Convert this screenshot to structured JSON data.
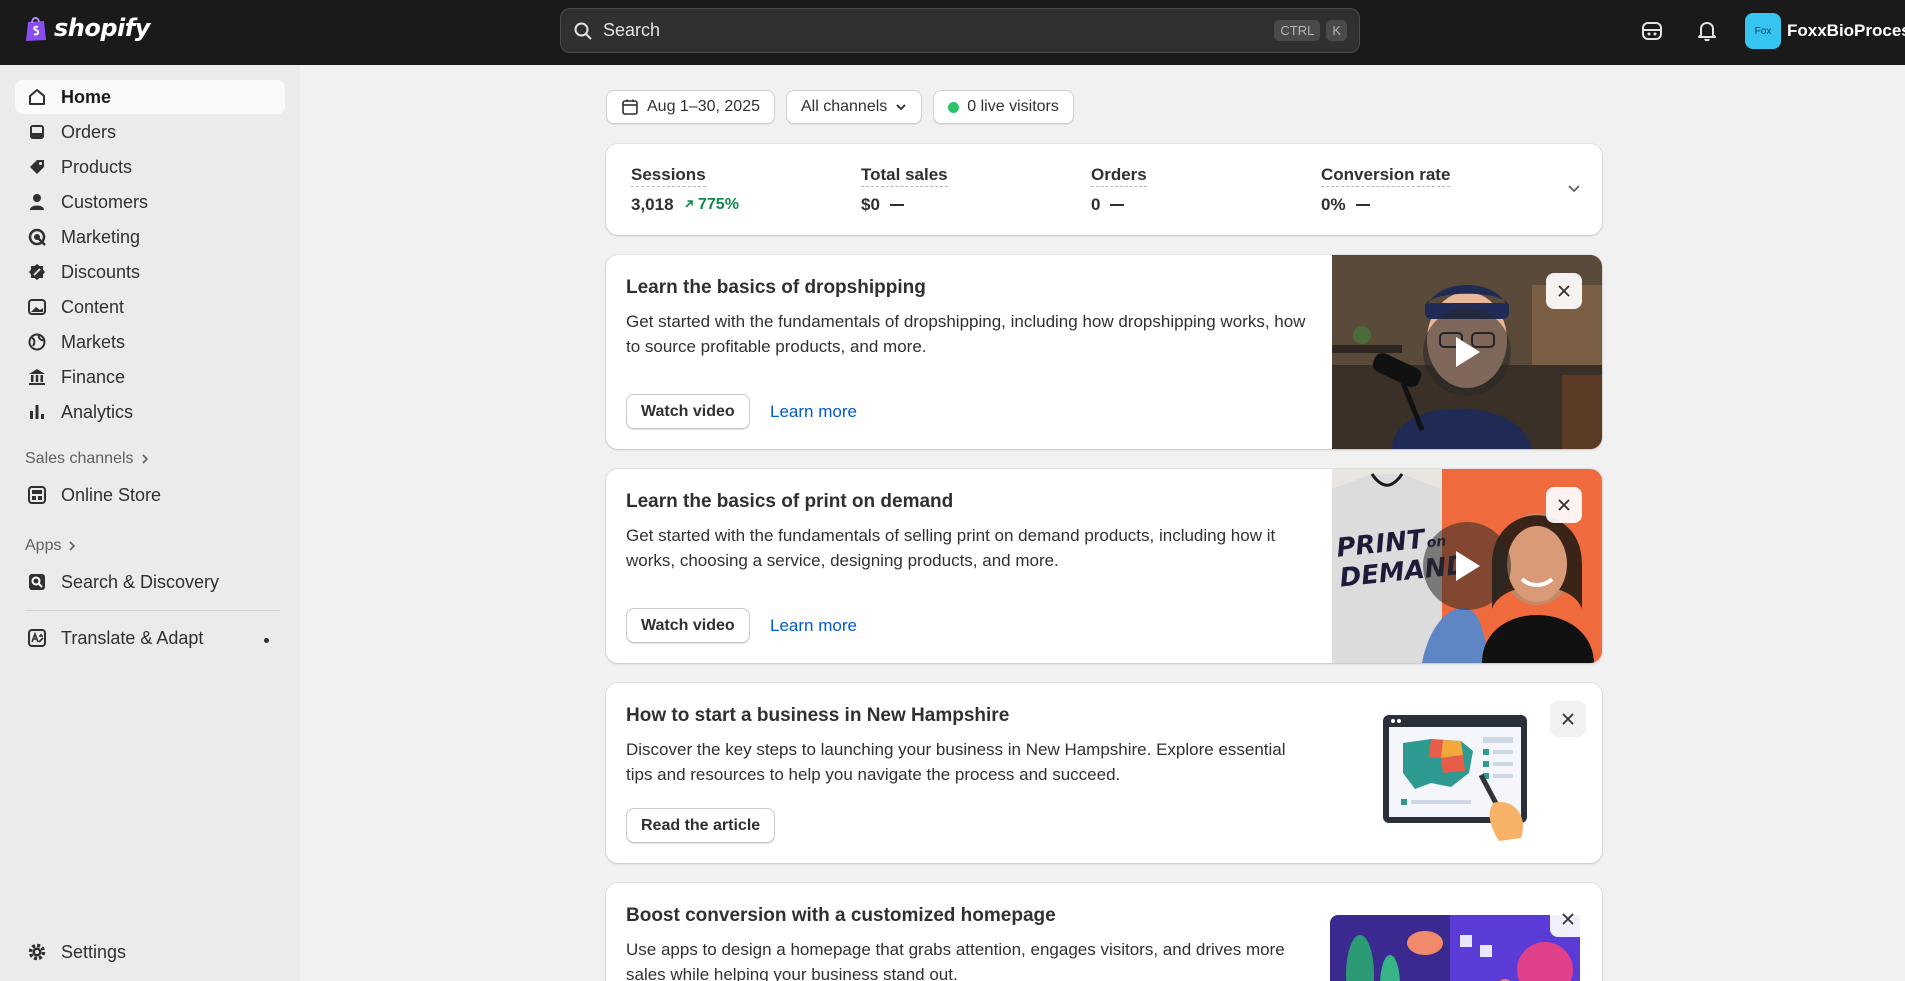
{
  "topbar": {
    "logo_text": "shopify",
    "search_placeholder": "Search",
    "shortcut_keys": [
      "CTRL",
      "K"
    ],
    "avatar_text": "Fox",
    "store_name": "FoxxBioProcess"
  },
  "sidebar": {
    "items": [
      {
        "label": "Home",
        "icon": "home-icon"
      },
      {
        "label": "Orders",
        "icon": "inbox-icon"
      },
      {
        "label": "Products",
        "icon": "tag-icon"
      },
      {
        "label": "Customers",
        "icon": "person-icon"
      },
      {
        "label": "Marketing",
        "icon": "target-icon"
      },
      {
        "label": "Discounts",
        "icon": "discount-icon"
      },
      {
        "label": "Content",
        "icon": "image-icon"
      },
      {
        "label": "Markets",
        "icon": "globe-icon"
      },
      {
        "label": "Finance",
        "icon": "bank-icon"
      },
      {
        "label": "Analytics",
        "icon": "bar-chart-icon"
      }
    ],
    "sales_channels_label": "Sales channels",
    "online_store_label": "Online Store",
    "apps_label": "Apps",
    "apps": [
      "Search & Discovery",
      "Translate & Adapt"
    ],
    "settings_label": "Settings"
  },
  "filters": {
    "date_range": "Aug 1–30, 2025",
    "channel": "All channels",
    "live_visitors": "0 live visitors"
  },
  "metrics": [
    {
      "label": "Sessions",
      "value": "3,018",
      "change": "775%"
    },
    {
      "label": "Total sales",
      "value": "$0",
      "change": ""
    },
    {
      "label": "Orders",
      "value": "0",
      "change": ""
    },
    {
      "label": "Conversion rate",
      "value": "0%",
      "change": ""
    }
  ],
  "cards": [
    {
      "title": "Learn the basics of dropshipping",
      "description": "Get started with the fundamentals of dropshipping, including how dropshipping works, how to source profitable products, and more.",
      "primary": "Watch video",
      "secondary": "Learn more"
    },
    {
      "title": "Learn the basics of print on demand",
      "description": "Get started with the fundamentals of selling print on demand products, including how it works, choosing a service, designing products, and more.",
      "primary": "Watch video",
      "secondary": "Learn more",
      "shirt_text_1": "PRINT",
      "shirt_text_2": "on",
      "shirt_text_3": "DEMAND"
    },
    {
      "title": "How to start a business in New Hampshire",
      "description": "Discover the key steps to launching your business in New Hampshire. Explore essential tips and resources to help you navigate the process and succeed.",
      "primary": "Read the article"
    },
    {
      "title": "Boost conversion with a customized homepage",
      "description": "Use apps to design a homepage that grabs attention, engages visitors, and drives more sales while helping your business stand out."
    }
  ],
  "colors": {
    "topbar": "#1a1a1a",
    "sidebar": "#ebebeb",
    "link": "#005bd3",
    "positive": "#0c8a4b",
    "live": "#29c46a"
  }
}
